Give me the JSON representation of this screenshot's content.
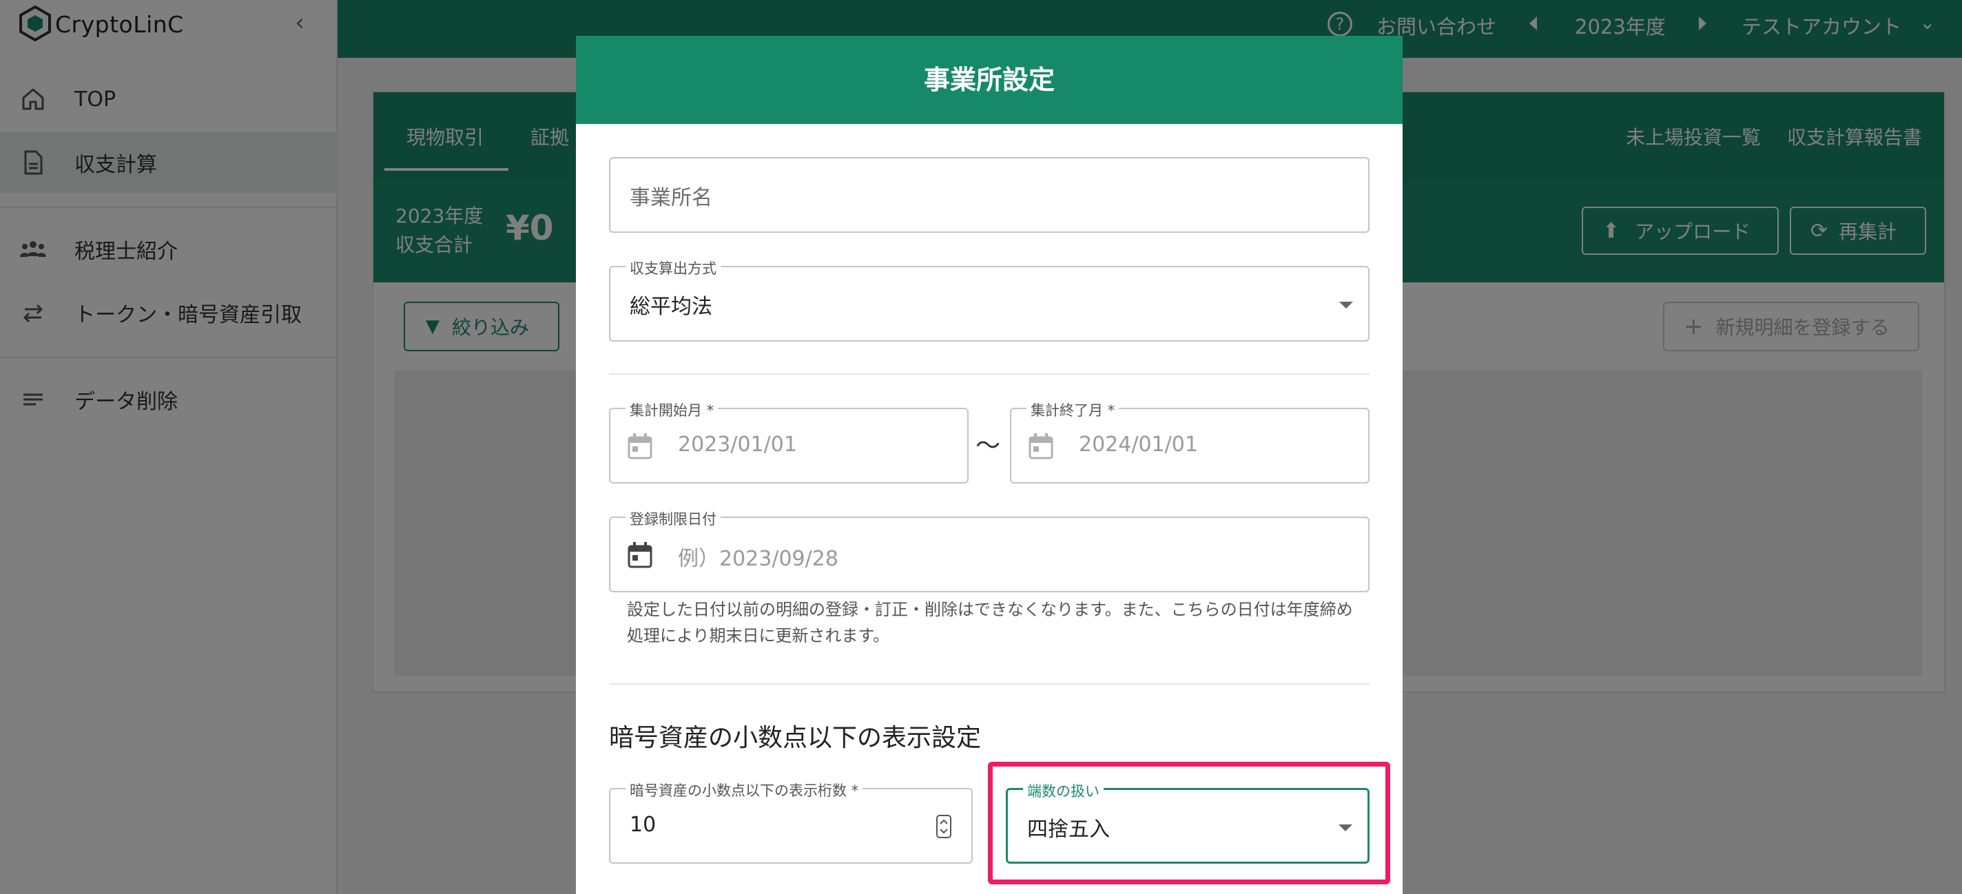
{
  "brand": {
    "name": "CryptoLinC"
  },
  "sidebar": {
    "items": [
      {
        "label": "TOP",
        "icon": "home-icon"
      },
      {
        "label": "収支計算",
        "icon": "document-icon",
        "active": true
      },
      {
        "label": "税理士紹介",
        "icon": "people-icon"
      },
      {
        "label": "トークン・暗号資産引取",
        "icon": "swap-icon"
      },
      {
        "label": "データ削除",
        "icon": "lines-icon"
      }
    ]
  },
  "header": {
    "contact": "お問い合わせ",
    "year": "2023年度",
    "account": "テストアカウント"
  },
  "main": {
    "tabs": [
      "現物取引",
      "証拠"
    ],
    "right_links": [
      "未上場投資一覧",
      "収支計算報告書"
    ],
    "summary_label1": "2023年度",
    "summary_label2": "収支合計",
    "summary_amount": "¥0",
    "upload_label": "アップロード",
    "recalc_label": "再集計",
    "filter_label": "絞り込み",
    "new_entry_label": "新規明細を登録する"
  },
  "modal": {
    "title": "事業所設定",
    "office_name_placeholder": "事業所名",
    "calc_method_label": "収支算出方式",
    "calc_method_value": "総平均法",
    "start_label": "集計開始月 *",
    "start_value": "2023/01/01",
    "tilde": "〜",
    "end_label": "集計終了月 *",
    "end_value": "2024/01/01",
    "limit_label": "登録制限日付",
    "limit_placeholder": "例）2023/09/28",
    "limit_help": "設定した日付以前の明細の登録・訂正・削除はできなくなります。また、こちらの日付は年度締め処理により期末日に更新されます。",
    "section_title": "暗号資産の小数点以下の表示設定",
    "digits_label": "暗号資産の小数点以下の表示桁数 *",
    "digits_value": "10",
    "rounding_label": "端数の扱い",
    "rounding_value": "四捨五入"
  },
  "colors": {
    "brand_green": "#1b8a6b",
    "highlight": "#ee1d63"
  }
}
